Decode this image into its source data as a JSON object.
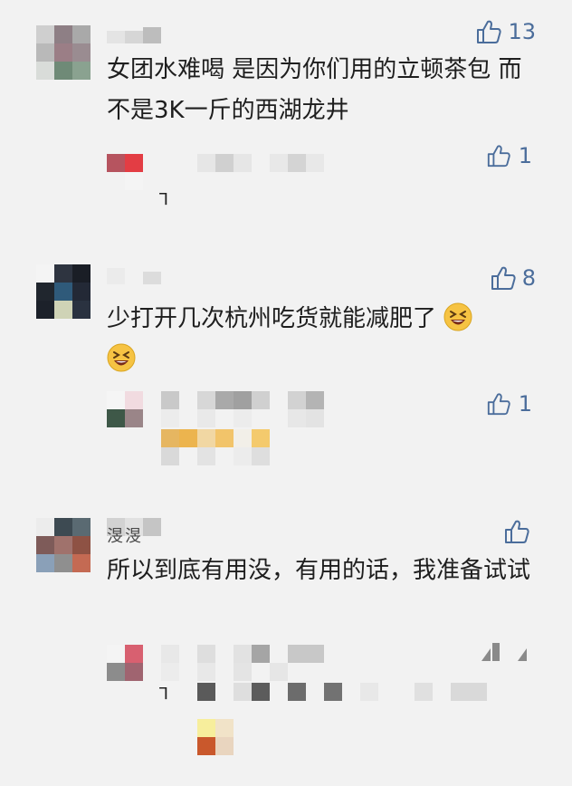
{
  "comments": [
    {
      "text": "女团水难喝 是因为你们用的立顿茶包 而不是3K一斤的西湖龙井",
      "likes": "13",
      "reply_likes": "1"
    },
    {
      "text": "少打开几次杭州吃货就能减肥了",
      "likes": "8",
      "reply_likes": "1",
      "emoji": [
        "grinning-squint-face",
        "grinning-squint-face"
      ]
    },
    {
      "username": "渂渂",
      "text": "所以到底有用没，有用的话，我准备试试",
      "likes": ""
    }
  ],
  "colors": {
    "accent": "#4b6d9b",
    "background": "#f2f2f2"
  }
}
